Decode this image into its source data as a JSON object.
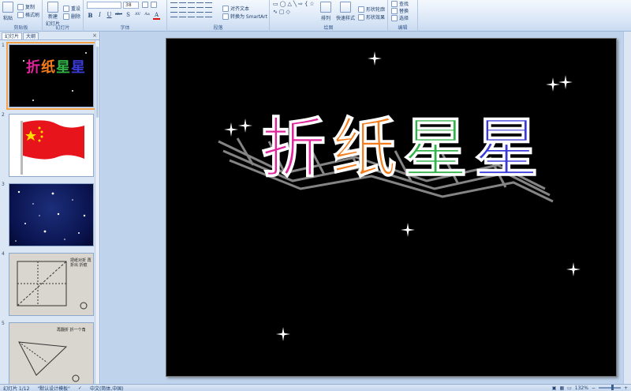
{
  "ribbon": {
    "clipboard": {
      "paste": "粘贴",
      "copy": "复制",
      "format_painter": "格式刷",
      "label": "剪贴板"
    },
    "slides": {
      "new_slide_line1": "新建",
      "new_slide_line2": "幻灯片",
      "reset": "重设",
      "delete": "删除",
      "label": "幻灯片"
    },
    "font": {
      "font_size": "38",
      "label": "字体",
      "format_buttons": [
        "B",
        "I",
        "U",
        "abc",
        "S",
        "AV",
        "Aa",
        "A"
      ]
    },
    "paragraph": {
      "align_text": "对齐文本",
      "convert_smartart": "转换为 SmartArt",
      "label": "段落"
    },
    "drawing": {
      "arrange": "排列",
      "quick_styles": "快速样式",
      "shape_outline": "形状轮廓",
      "shape_effects": "形状效果",
      "label": "绘图"
    },
    "editing": {
      "find": "查找",
      "replace": "替换",
      "select": "选择",
      "label": "编辑"
    }
  },
  "left_panel": {
    "tabs": [
      "幻灯片",
      "大纲"
    ],
    "close": "×",
    "slides": [
      {
        "num": "1",
        "title": "折纸星星"
      },
      {
        "num": "2"
      },
      {
        "num": "3"
      },
      {
        "num": "4",
        "note": "把纸对折 再折出 折痕"
      },
      {
        "num": "5",
        "note": "再翻折 折一个角"
      }
    ]
  },
  "slide": {
    "title_chars": [
      "折",
      "纸",
      "星",
      "星"
    ],
    "title_colors": [
      "#e0249b",
      "#f47c1c",
      "#34b24a",
      "#3a3ad8"
    ]
  },
  "status": {
    "slide_counter": "幻灯片 1/12",
    "theme": "\"默认设计模板\"",
    "language": "中文(简体,中国)",
    "zoom": "132%"
  }
}
